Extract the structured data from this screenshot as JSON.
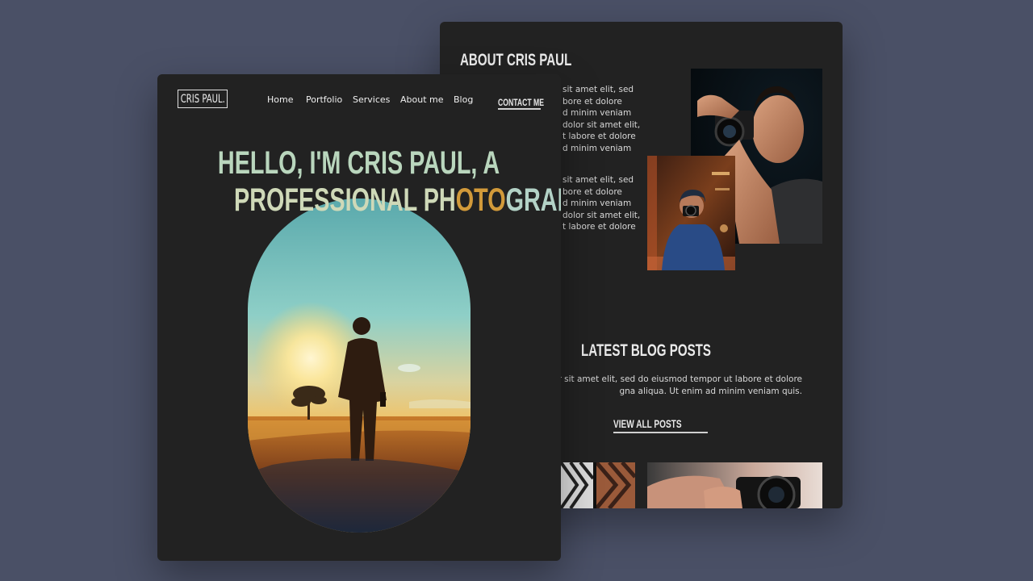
{
  "about": {
    "title": "ABOUT CRIS PAUL",
    "paragraph1": [
      "sit amet elit, sed",
      "bore et dolore",
      "d minim veniam",
      "dolor sit amet elit,",
      "t labore et dolore",
      "d minim veniam"
    ],
    "paragraph2": [
      "sit amet elit, sed",
      "bore et dolore",
      "d minim veniam",
      "dolor sit amet elit,",
      "t labore et dolore"
    ]
  },
  "blog": {
    "title": "LATEST BLOG POSTS",
    "description": [
      "dolor sit amet elit, sed do eiusmod tempor ut labore et dolore",
      "gna aliqua. Ut enim ad minim veniam quis."
    ],
    "view_all": "VIEW ALL POSTS"
  },
  "header": {
    "logo": "CRIS PAUL.",
    "nav": [
      "Home",
      "Portfolio",
      "Services",
      "About me",
      "Blog"
    ],
    "contact": "CONTACT ME"
  },
  "hero": {
    "line1": "HELLO, I'M CRIS PAUL, A",
    "line2": "PROFESSIONAL PHOTOGRAPHER."
  },
  "colors": {
    "page_background": "#4a5066",
    "card_background": "#222222",
    "hero_accent": "#d29a3a",
    "hero_mint": "#b3d2c6"
  }
}
